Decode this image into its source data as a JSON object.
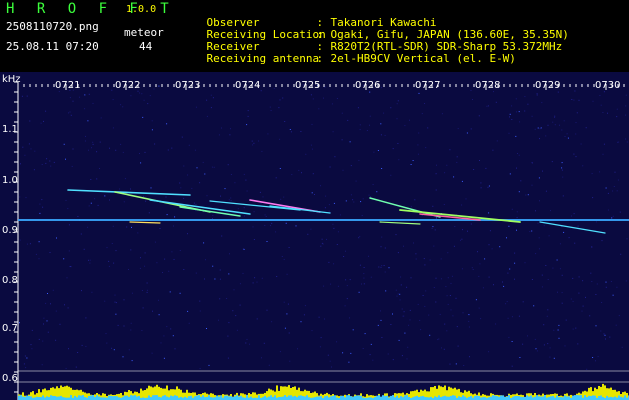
{
  "app": {
    "title": "H R O F F T",
    "version": "1.0.0"
  },
  "file": {
    "name": "2508110720.png",
    "datetime": "25.08.11 07:20"
  },
  "meteor": {
    "label": "meteor",
    "count": "44"
  },
  "info": [
    {
      "key": "Observer",
      "value": "Takanori Kawachi"
    },
    {
      "key": "Receiving Location",
      "value": "Ogaki, Gifu, JAPAN (136.60E, 35.35N)"
    },
    {
      "key": "Receiver",
      "value": "R820T2(RTL-SDR) SDR-Sharp 53.372MHz"
    },
    {
      "key": "Receiving antenna",
      "value": "2el-HB9CV Vertical (el. E-W)"
    }
  ],
  "axis": {
    "y_unit": "kHz",
    "y_ticks": [
      "1.1",
      "1.0",
      "0.9",
      "0.8",
      "0.7",
      "0.6"
    ],
    "x_ticks": [
      "0721",
      "0722",
      "0723",
      "0724",
      "0725",
      "0726",
      "0727",
      "0728",
      "0729",
      "0730"
    ]
  },
  "colors": {
    "title": "#3cff3c",
    "info": "#ffff00",
    "background": "#0a0a40",
    "signal": "#40c8ff"
  }
}
